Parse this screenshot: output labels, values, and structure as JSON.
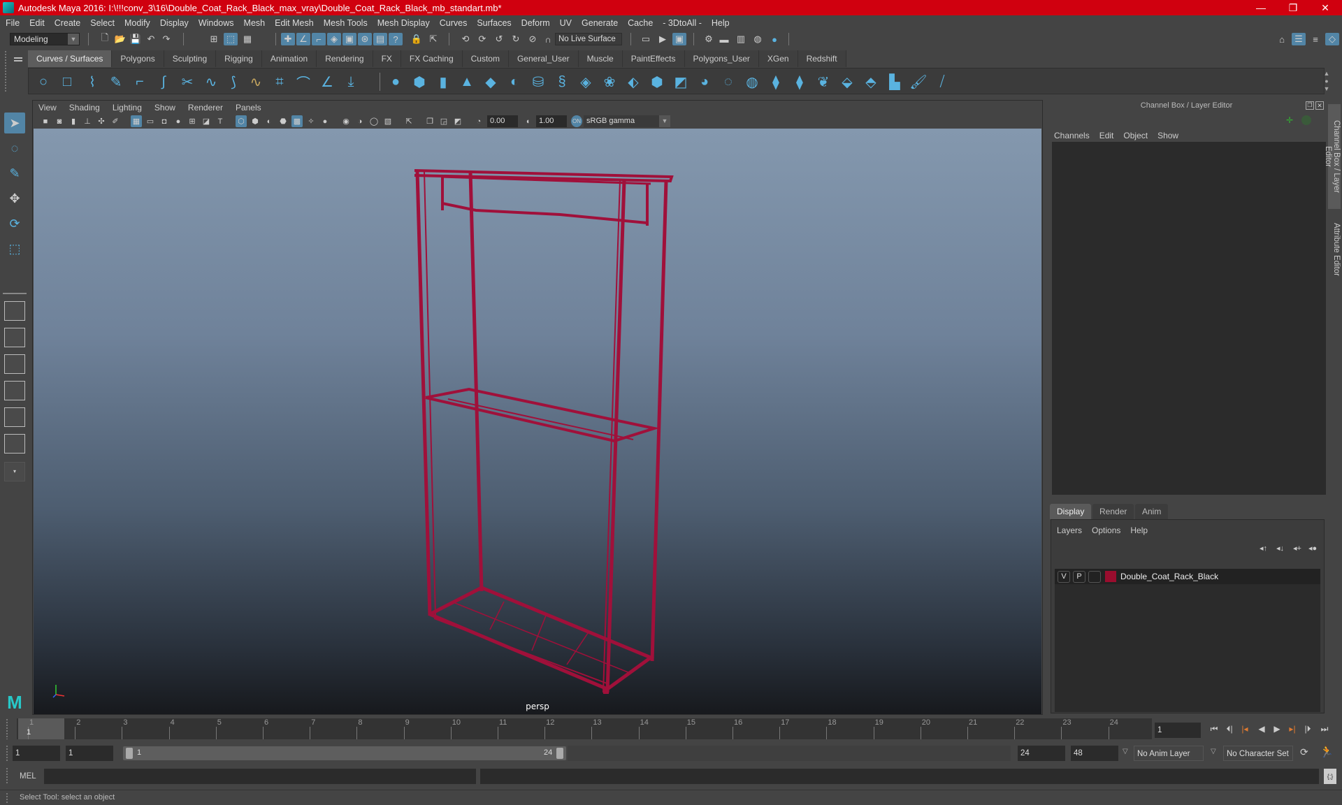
{
  "window": {
    "title": "Autodesk Maya 2016: I:\\!!!conv_3\\16\\Double_Coat_Rack_Black_max_vray\\Double_Coat_Rack_Black_mb_standart.mb*",
    "controls": {
      "minimize": "—",
      "maximize": "❐",
      "close": "✕"
    }
  },
  "menubar": [
    "File",
    "Edit",
    "Create",
    "Select",
    "Modify",
    "Display",
    "Windows",
    "Mesh",
    "Edit Mesh",
    "Mesh Tools",
    "Mesh Display",
    "Curves",
    "Surfaces",
    "Deform",
    "UV",
    "Generate",
    "Cache",
    "- 3DtoAll -",
    "Help"
  ],
  "statusline": {
    "mode": "Modeling",
    "live_surface": "No Live Surface"
  },
  "shelf": {
    "tabs": [
      "Curves / Surfaces",
      "Polygons",
      "Sculpting",
      "Rigging",
      "Animation",
      "Rendering",
      "FX",
      "FX Caching",
      "Custom",
      "General_User",
      "Muscle",
      "PaintEffects",
      "Polygons_User",
      "XGen",
      "Redshift"
    ],
    "active_tab": "Curves / Surfaces"
  },
  "viewport": {
    "menu": [
      "View",
      "Shading",
      "Lighting",
      "Show",
      "Renderer",
      "Panels"
    ],
    "exposure": "0.00",
    "gamma": "1.00",
    "color_space": "sRGB gamma",
    "camera_label": "persp",
    "object_color": "#a0103a"
  },
  "channel_box": {
    "title": "Channel Box / Layer Editor",
    "menu": [
      "Channels",
      "Edit",
      "Object",
      "Show"
    ]
  },
  "layer_editor": {
    "tabs": [
      "Display",
      "Render",
      "Anim"
    ],
    "active_tab": "Display",
    "menu": [
      "Layers",
      "Options",
      "Help"
    ],
    "layers": [
      {
        "v": "V",
        "p": "P",
        "color": "#9a0d2e",
        "name": "Double_Coat_Rack_Black"
      }
    ]
  },
  "side_tabs": [
    "Channel Box / Layer Editor",
    "Attribute Editor"
  ],
  "timeline": {
    "ticks": [
      "1",
      "2",
      "3",
      "4",
      "5",
      "6",
      "7",
      "8",
      "9",
      "10",
      "11",
      "12",
      "13",
      "14",
      "15",
      "16",
      "17",
      "18",
      "19",
      "20",
      "21",
      "22",
      "23",
      "24"
    ],
    "current_frame": "1",
    "current_frame_field": "1"
  },
  "range": {
    "start": "1",
    "playback_start": "1",
    "slider_start": "1",
    "slider_end": "24",
    "playback_end": "24",
    "end": "48",
    "anim_layer": "No Anim Layer",
    "character_set": "No Character Set"
  },
  "command_line": {
    "label": "MEL",
    "value": ""
  },
  "help_line": "Select Tool: select an object"
}
